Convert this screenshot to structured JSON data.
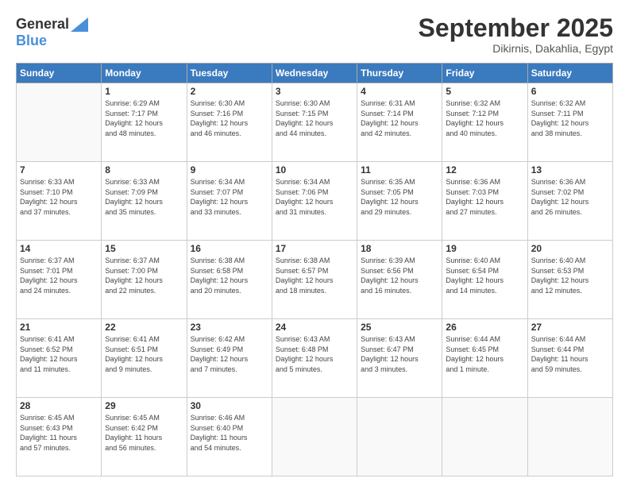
{
  "header": {
    "logo_general": "General",
    "logo_blue": "Blue",
    "month": "September 2025",
    "location": "Dikirnis, Dakahlia, Egypt"
  },
  "days_of_week": [
    "Sunday",
    "Monday",
    "Tuesday",
    "Wednesday",
    "Thursday",
    "Friday",
    "Saturday"
  ],
  "weeks": [
    [
      {
        "day": "",
        "text": ""
      },
      {
        "day": "1",
        "text": "Sunrise: 6:29 AM\nSunset: 7:17 PM\nDaylight: 12 hours\nand 48 minutes."
      },
      {
        "day": "2",
        "text": "Sunrise: 6:30 AM\nSunset: 7:16 PM\nDaylight: 12 hours\nand 46 minutes."
      },
      {
        "day": "3",
        "text": "Sunrise: 6:30 AM\nSunset: 7:15 PM\nDaylight: 12 hours\nand 44 minutes."
      },
      {
        "day": "4",
        "text": "Sunrise: 6:31 AM\nSunset: 7:14 PM\nDaylight: 12 hours\nand 42 minutes."
      },
      {
        "day": "5",
        "text": "Sunrise: 6:32 AM\nSunset: 7:12 PM\nDaylight: 12 hours\nand 40 minutes."
      },
      {
        "day": "6",
        "text": "Sunrise: 6:32 AM\nSunset: 7:11 PM\nDaylight: 12 hours\nand 38 minutes."
      }
    ],
    [
      {
        "day": "7",
        "text": "Sunrise: 6:33 AM\nSunset: 7:10 PM\nDaylight: 12 hours\nand 37 minutes."
      },
      {
        "day": "8",
        "text": "Sunrise: 6:33 AM\nSunset: 7:09 PM\nDaylight: 12 hours\nand 35 minutes."
      },
      {
        "day": "9",
        "text": "Sunrise: 6:34 AM\nSunset: 7:07 PM\nDaylight: 12 hours\nand 33 minutes."
      },
      {
        "day": "10",
        "text": "Sunrise: 6:34 AM\nSunset: 7:06 PM\nDaylight: 12 hours\nand 31 minutes."
      },
      {
        "day": "11",
        "text": "Sunrise: 6:35 AM\nSunset: 7:05 PM\nDaylight: 12 hours\nand 29 minutes."
      },
      {
        "day": "12",
        "text": "Sunrise: 6:36 AM\nSunset: 7:03 PM\nDaylight: 12 hours\nand 27 minutes."
      },
      {
        "day": "13",
        "text": "Sunrise: 6:36 AM\nSunset: 7:02 PM\nDaylight: 12 hours\nand 26 minutes."
      }
    ],
    [
      {
        "day": "14",
        "text": "Sunrise: 6:37 AM\nSunset: 7:01 PM\nDaylight: 12 hours\nand 24 minutes."
      },
      {
        "day": "15",
        "text": "Sunrise: 6:37 AM\nSunset: 7:00 PM\nDaylight: 12 hours\nand 22 minutes."
      },
      {
        "day": "16",
        "text": "Sunrise: 6:38 AM\nSunset: 6:58 PM\nDaylight: 12 hours\nand 20 minutes."
      },
      {
        "day": "17",
        "text": "Sunrise: 6:38 AM\nSunset: 6:57 PM\nDaylight: 12 hours\nand 18 minutes."
      },
      {
        "day": "18",
        "text": "Sunrise: 6:39 AM\nSunset: 6:56 PM\nDaylight: 12 hours\nand 16 minutes."
      },
      {
        "day": "19",
        "text": "Sunrise: 6:40 AM\nSunset: 6:54 PM\nDaylight: 12 hours\nand 14 minutes."
      },
      {
        "day": "20",
        "text": "Sunrise: 6:40 AM\nSunset: 6:53 PM\nDaylight: 12 hours\nand 12 minutes."
      }
    ],
    [
      {
        "day": "21",
        "text": "Sunrise: 6:41 AM\nSunset: 6:52 PM\nDaylight: 12 hours\nand 11 minutes."
      },
      {
        "day": "22",
        "text": "Sunrise: 6:41 AM\nSunset: 6:51 PM\nDaylight: 12 hours\nand 9 minutes."
      },
      {
        "day": "23",
        "text": "Sunrise: 6:42 AM\nSunset: 6:49 PM\nDaylight: 12 hours\nand 7 minutes."
      },
      {
        "day": "24",
        "text": "Sunrise: 6:43 AM\nSunset: 6:48 PM\nDaylight: 12 hours\nand 5 minutes."
      },
      {
        "day": "25",
        "text": "Sunrise: 6:43 AM\nSunset: 6:47 PM\nDaylight: 12 hours\nand 3 minutes."
      },
      {
        "day": "26",
        "text": "Sunrise: 6:44 AM\nSunset: 6:45 PM\nDaylight: 12 hours\nand 1 minute."
      },
      {
        "day": "27",
        "text": "Sunrise: 6:44 AM\nSunset: 6:44 PM\nDaylight: 11 hours\nand 59 minutes."
      }
    ],
    [
      {
        "day": "28",
        "text": "Sunrise: 6:45 AM\nSunset: 6:43 PM\nDaylight: 11 hours\nand 57 minutes."
      },
      {
        "day": "29",
        "text": "Sunrise: 6:45 AM\nSunset: 6:42 PM\nDaylight: 11 hours\nand 56 minutes."
      },
      {
        "day": "30",
        "text": "Sunrise: 6:46 AM\nSunset: 6:40 PM\nDaylight: 11 hours\nand 54 minutes."
      },
      {
        "day": "",
        "text": ""
      },
      {
        "day": "",
        "text": ""
      },
      {
        "day": "",
        "text": ""
      },
      {
        "day": "",
        "text": ""
      }
    ]
  ]
}
